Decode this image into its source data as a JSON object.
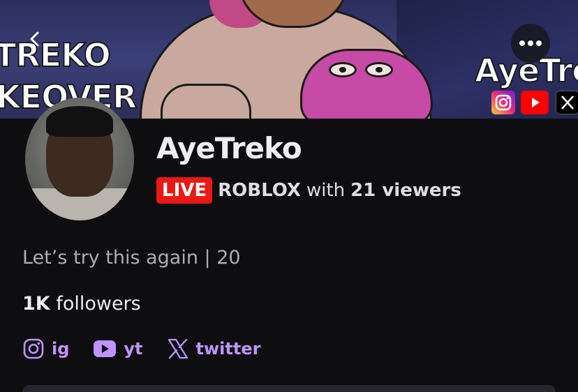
{
  "banner": {
    "text_left_1": "TREKO",
    "text_left_2": "KEOVER",
    "text_right": "AyeTre",
    "socials": [
      "instagram-icon",
      "youtube-icon",
      "x-icon"
    ]
  },
  "nav": {
    "back_icon": "chevron-left-icon",
    "more_icon": "more-horizontal-icon"
  },
  "profile": {
    "username": "AyeTreko",
    "live_label": "LIVE",
    "game": "ROBLOX",
    "with_text": "with",
    "viewers": "21 viewers",
    "bio": "Let’s try this again | 20",
    "followers_count": "1K",
    "followers_label": "followers"
  },
  "links": [
    {
      "icon": "instagram-icon",
      "label": "ig"
    },
    {
      "icon": "youtube-icon",
      "label": "yt"
    },
    {
      "icon": "x-icon",
      "label": "twitter"
    }
  ],
  "colors": {
    "background": "#0e0e10",
    "accent": "#bf94ff",
    "live": "#e91916"
  }
}
